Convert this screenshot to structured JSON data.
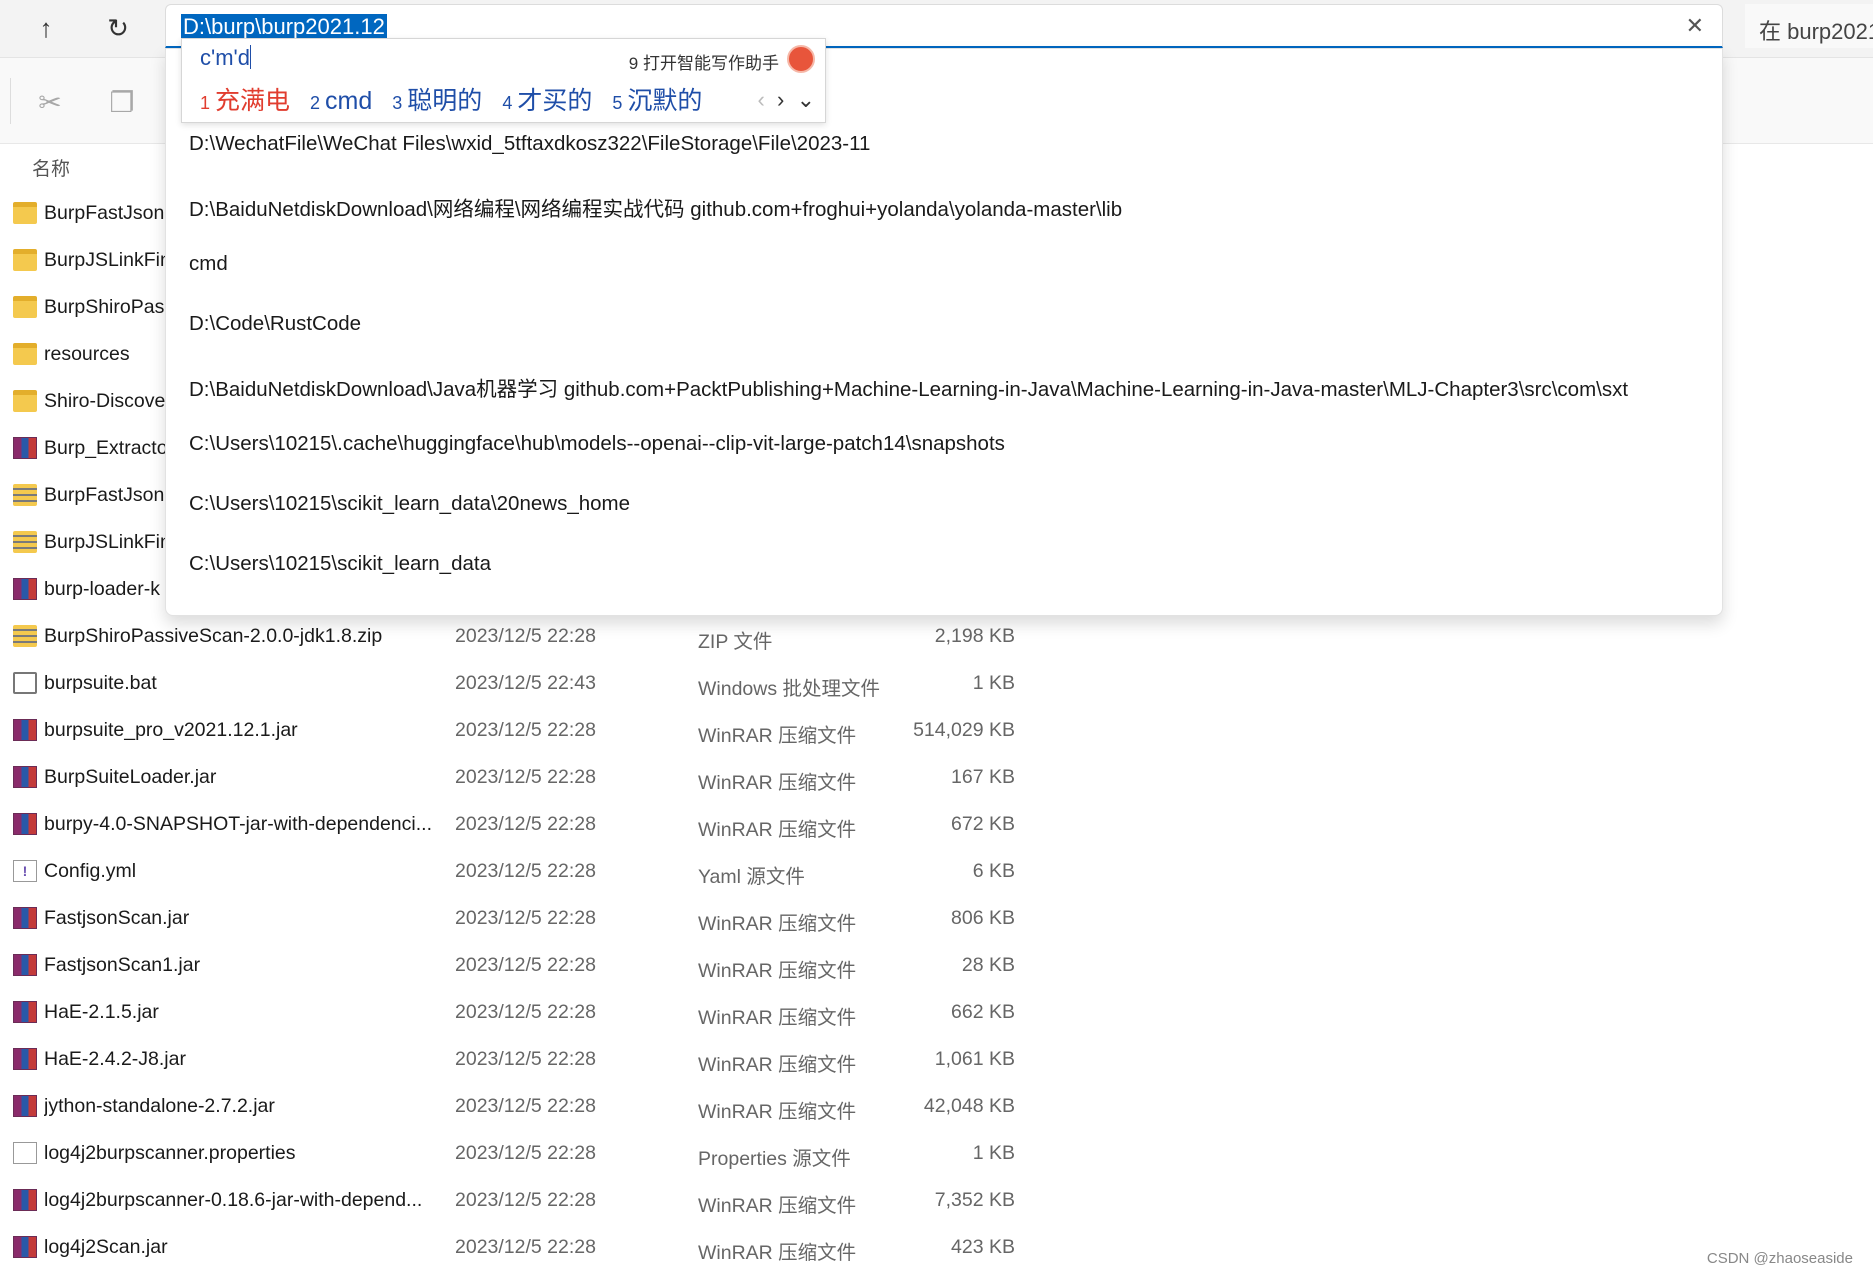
{
  "nav": {
    "up_icon": "↑",
    "refresh_icon": "↻"
  },
  "address": {
    "value": "D:\\burp\\burp2021.12",
    "clear_icon": "✕"
  },
  "search": {
    "placeholder": "在 burp2021"
  },
  "toolbar": {
    "cut_icon": "✂",
    "copy_icon": "❐"
  },
  "columns": {
    "name": "名称"
  },
  "ime": {
    "composition": "c'm'd",
    "assist_num": "9",
    "assist_label": "打开智能写作助手",
    "candidates": [
      {
        "num": "1",
        "text": "充满电"
      },
      {
        "num": "2",
        "text": "cmd"
      },
      {
        "num": "3",
        "text": "聪明的"
      },
      {
        "num": "4",
        "text": "才买的"
      },
      {
        "num": "5",
        "text": "沉默的"
      }
    ],
    "prev_icon": "‹",
    "next_icon": "›",
    "expand_icon": "⌄"
  },
  "suggestions": [
    "D:\\WechatFile\\WeChat Files\\wxid_5tftaxdkosz322\\FileStorage\\File\\2023-11",
    "D:\\BaiduNetdiskDownload\\网络编程\\网络编程实战代码 github.com+froghui+yolanda\\yolanda-master\\lib",
    "cmd",
    "D:\\Code\\RustCode",
    "D:\\BaiduNetdiskDownload\\Java机器学习 github.com+PacktPublishing+Machine-Learning-in-Java\\Machine-Learning-in-Java-master\\MLJ-Chapter3\\src\\com\\sxt",
    "C:\\Users\\10215\\.cache\\huggingface\\hub\\models--openai--clip-vit-large-patch14\\snapshots",
    "C:\\Users\\10215\\scikit_learn_data\\20news_home",
    "C:\\Users\\10215\\scikit_learn_data"
  ],
  "files": [
    {
      "name": "BurpFastJsonScan",
      "date": "",
      "type": "",
      "size": "",
      "icon": "folder"
    },
    {
      "name": "BurpJSLinkFinder",
      "date": "",
      "type": "",
      "size": "",
      "icon": "folder"
    },
    {
      "name": "BurpShiroPassiveScan",
      "date": "",
      "type": "",
      "size": "",
      "icon": "folder"
    },
    {
      "name": "resources",
      "date": "",
      "type": "",
      "size": "",
      "icon": "folder"
    },
    {
      "name": "Shiro-Discovery",
      "date": "",
      "type": "",
      "size": "",
      "icon": "folder"
    },
    {
      "name": "Burp_Extractor",
      "date": "",
      "type": "",
      "size": "",
      "icon": "rar"
    },
    {
      "name": "BurpFastJsonScan",
      "date": "",
      "type": "",
      "size": "",
      "icon": "zip"
    },
    {
      "name": "BurpJSLinkFinder",
      "date": "",
      "type": "",
      "size": "",
      "icon": "zip"
    },
    {
      "name": "burp-loader-k",
      "date": "",
      "type": "",
      "size": "",
      "icon": "rar"
    },
    {
      "name": "BurpShiroPassiveScan-2.0.0-jdk1.8.zip",
      "date": "2023/12/5 22:28",
      "type": "ZIP 文件",
      "size": "2,198 KB",
      "icon": "zip"
    },
    {
      "name": "burpsuite.bat",
      "date": "2023/12/5 22:43",
      "type": "Windows 批处理文件",
      "size": "1 KB",
      "icon": "bat"
    },
    {
      "name": "burpsuite_pro_v2021.12.1.jar",
      "date": "2023/12/5 22:28",
      "type": "WinRAR 压缩文件",
      "size": "514,029 KB",
      "icon": "rar"
    },
    {
      "name": "BurpSuiteLoader.jar",
      "date": "2023/12/5 22:28",
      "type": "WinRAR 压缩文件",
      "size": "167 KB",
      "icon": "rar"
    },
    {
      "name": "burpy-4.0-SNAPSHOT-jar-with-dependenci...",
      "date": "2023/12/5 22:28",
      "type": "WinRAR 压缩文件",
      "size": "672 KB",
      "icon": "rar"
    },
    {
      "name": "Config.yml",
      "date": "2023/12/5 22:28",
      "type": "Yaml 源文件",
      "size": "6 KB",
      "icon": "yml"
    },
    {
      "name": "FastjsonScan.jar",
      "date": "2023/12/5 22:28",
      "type": "WinRAR 压缩文件",
      "size": "806 KB",
      "icon": "rar"
    },
    {
      "name": "FastjsonScan1.jar",
      "date": "2023/12/5 22:28",
      "type": "WinRAR 压缩文件",
      "size": "28 KB",
      "icon": "rar"
    },
    {
      "name": "HaE-2.1.5.jar",
      "date": "2023/12/5 22:28",
      "type": "WinRAR 压缩文件",
      "size": "662 KB",
      "icon": "rar"
    },
    {
      "name": "HaE-2.4.2-J8.jar",
      "date": "2023/12/5 22:28",
      "type": "WinRAR 压缩文件",
      "size": "1,061 KB",
      "icon": "rar"
    },
    {
      "name": "jython-standalone-2.7.2.jar",
      "date": "2023/12/5 22:28",
      "type": "WinRAR 压缩文件",
      "size": "42,048 KB",
      "icon": "rar"
    },
    {
      "name": "log4j2burpscanner.properties",
      "date": "2023/12/5 22:28",
      "type": "Properties 源文件",
      "size": "1 KB",
      "icon": "props"
    },
    {
      "name": "log4j2burpscanner-0.18.6-jar-with-depend...",
      "date": "2023/12/5 22:28",
      "type": "WinRAR 压缩文件",
      "size": "7,352 KB",
      "icon": "rar"
    },
    {
      "name": "log4j2Scan.jar",
      "date": "2023/12/5 22:28",
      "type": "WinRAR 压缩文件",
      "size": "423 KB",
      "icon": "rar"
    }
  ],
  "watermark": "CSDN @zhaoseaside"
}
